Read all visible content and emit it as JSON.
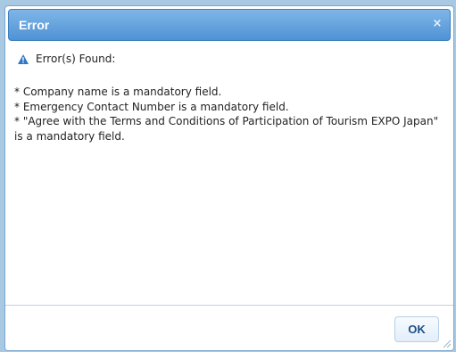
{
  "dialog": {
    "title": "Error",
    "close_glyph": "×",
    "heading": "Error(s) Found:",
    "heading_icon": "warning-triangle-icon",
    "messages": [
      "* Company name is a mandatory field.",
      "* Emergency Contact Number is a mandatory field.",
      "* \"Agree with the Terms and Conditions of Participation of Tourism EXPO Japan\" is a mandatory field."
    ],
    "ok_label": "OK"
  },
  "colors": {
    "titlebar": "#4f92d4",
    "icon": "#2f78c4",
    "button_text": "#1d4f86"
  }
}
